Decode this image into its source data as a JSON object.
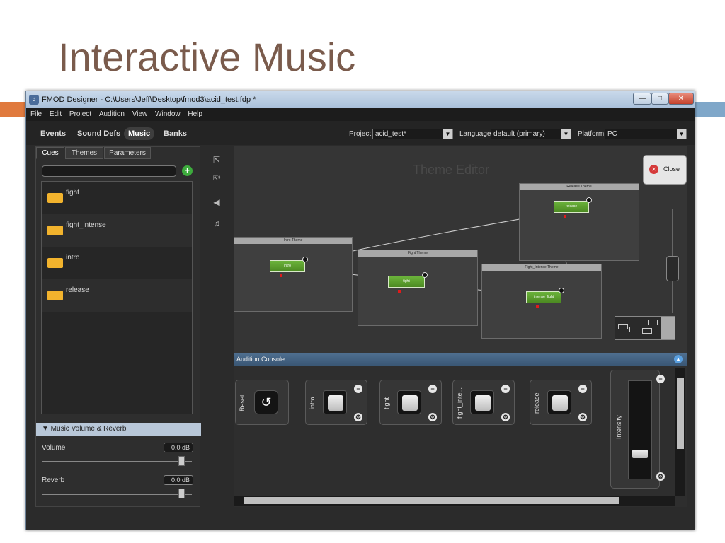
{
  "slide": {
    "title": "Interactive Music"
  },
  "window": {
    "title": "FMOD Designer - C:\\Users\\Jeff\\Desktop\\fmod3\\acid_test.fdp *",
    "minimize": "—",
    "maximize": "□",
    "close": "✕"
  },
  "menu": [
    "File",
    "Edit",
    "Project",
    "Audition",
    "View",
    "Window",
    "Help"
  ],
  "nav": {
    "tabs": [
      "Events",
      "Sound Defs",
      "Music",
      "Banks"
    ],
    "active": "Music",
    "project_label": "Project",
    "project_value": "acid_test*",
    "language_label": "Language",
    "language_value": "default (primary)",
    "platform_label": "Platform",
    "platform_value": "PC"
  },
  "left": {
    "tabs": [
      "Cues",
      "Themes",
      "Parameters"
    ],
    "cues": [
      "fight",
      "fight_intense",
      "intro",
      "release"
    ],
    "section": "▼ Music Volume & Reverb",
    "volume_label": "Volume",
    "volume_value": "0.0 dB",
    "volume_level": 0.95,
    "reverb_label": "Reverb",
    "reverb_value": "0.0 dB",
    "reverb_level": 0.95
  },
  "tools": [
    "arrow-select-icon",
    "number-select-icon",
    "speaker-icon",
    "music-note-icon"
  ],
  "editor": {
    "title": "Theme Editor",
    "close_label": "Close",
    "themes": [
      {
        "name": "Intro Theme",
        "cue": "intro"
      },
      {
        "name": "Fight Theme",
        "cue": "fight"
      },
      {
        "name": "Fight_Intense Theme",
        "cue": "intense_fight"
      },
      {
        "name": "Release Theme",
        "cue": "release"
      }
    ]
  },
  "console": {
    "title": "Audition Console",
    "reset_label": "Reset",
    "cues": [
      "intro",
      "fight",
      "fight_inte...",
      "release"
    ],
    "intensity_label": "Intensity"
  },
  "colors": {
    "accent_orange": "#e07a3e",
    "accent_blue": "#7fa7c9",
    "cue_green": "#5a9d2e",
    "title_brown": "#7a5b4c"
  }
}
